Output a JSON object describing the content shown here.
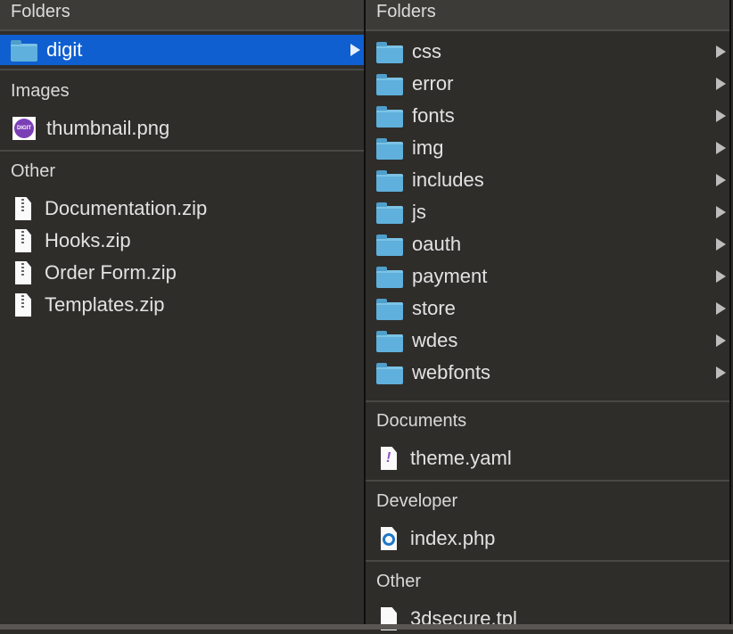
{
  "left": {
    "header": "Folders",
    "folders": [
      {
        "label": "digit",
        "icon": "folder-icon",
        "selected": true
      }
    ],
    "images": {
      "label": "Images",
      "items": [
        {
          "label": "thumbnail.png",
          "icon": "image-thumbnail-icon",
          "thumb_text": "DIGIT"
        }
      ]
    },
    "other": {
      "label": "Other",
      "items": [
        {
          "label": "Documentation.zip"
        },
        {
          "label": "Hooks.zip"
        },
        {
          "label": "Order Form.zip"
        },
        {
          "label": "Templates.zip"
        }
      ]
    }
  },
  "right": {
    "header": "Folders",
    "folders": [
      {
        "label": "css"
      },
      {
        "label": "error"
      },
      {
        "label": "fonts"
      },
      {
        "label": "img"
      },
      {
        "label": "includes"
      },
      {
        "label": "js"
      },
      {
        "label": "oauth"
      },
      {
        "label": "payment"
      },
      {
        "label": "store"
      },
      {
        "label": "wdes"
      },
      {
        "label": "webfonts"
      }
    ],
    "documents": {
      "label": "Documents",
      "items": [
        {
          "label": "theme.yaml",
          "icon": "yaml-file-icon"
        }
      ]
    },
    "developer": {
      "label": "Developer",
      "items": [
        {
          "label": "index.php",
          "icon": "php-file-icon"
        }
      ]
    },
    "other": {
      "label": "Other",
      "items": [
        {
          "label": "3dsecure.tpl",
          "icon": "document-icon"
        }
      ]
    }
  },
  "colors": {
    "selection": "#0f5fd0",
    "folder": "#5fb0dc",
    "background": "#2f2d2a"
  }
}
